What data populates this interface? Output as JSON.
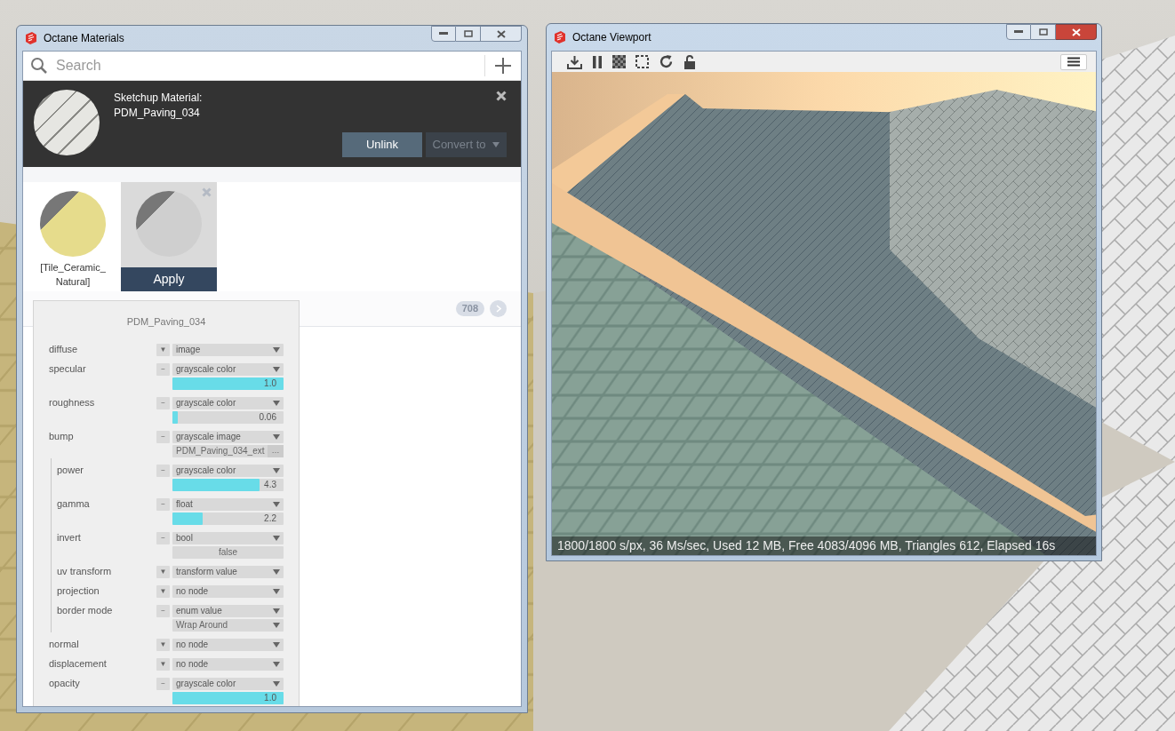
{
  "materials_window": {
    "title": "Octane Materials",
    "search": {
      "placeholder": "Search"
    },
    "linked_material": {
      "heading": "Sketchup Material:",
      "name": "PDM_Paving_034",
      "buttons": [
        {
          "label": "Unlink",
          "kind": "primary",
          "disabled": false
        },
        {
          "label": "Convert to",
          "kind": "dropdown",
          "disabled": true
        }
      ]
    },
    "materials": [
      {
        "name": "[Tile_Ceramic_Natural]",
        "selected": false,
        "color": "#e6dc8c"
      },
      {
        "selected": true,
        "action": "Apply",
        "color": "#cfcfcf"
      }
    ],
    "category_count": "708",
    "editor": {
      "title": "PDM_Paving_034",
      "params": [
        {
          "label": "diffuse",
          "toggle": "▼",
          "type": "image"
        },
        {
          "label": "specular",
          "toggle": "−",
          "type": "grayscale color",
          "sub": {
            "kind": "slider",
            "level": 1,
            "reading": "1.0"
          }
        },
        {
          "label": "roughness",
          "toggle": "−",
          "type": "grayscale color",
          "sub": {
            "kind": "slider",
            "level": 0.05,
            "reading": "0.06"
          }
        },
        {
          "label": "bump",
          "toggle": "−",
          "type": "grayscale image",
          "sub": {
            "kind": "file",
            "value": "PDM_Paving_034_ext",
            "button": "…"
          },
          "children": [
            {
              "label": "power",
              "toggle": "−",
              "type": "grayscale color",
              "sub": {
                "kind": "slider",
                "level": 0.78,
                "reading": "4.3"
              }
            },
            {
              "label": "gamma",
              "toggle": "−",
              "type": "float",
              "sub": {
                "kind": "slider",
                "level": 0.27,
                "reading": "2.2"
              }
            },
            {
              "label": "invert",
              "toggle": "−",
              "type": "bool",
              "sub": {
                "kind": "value",
                "value": "false"
              }
            },
            {
              "label": "uv transform",
              "toggle": "▼",
              "type": "transform value"
            },
            {
              "label": "projection",
              "toggle": "▼",
              "type": "no node"
            },
            {
              "label": "border mode",
              "toggle": "−",
              "type": "enum value",
              "sub": {
                "kind": "enum",
                "value": "Wrap Around"
              }
            }
          ]
        },
        {
          "label": "normal",
          "toggle": "▼",
          "type": "no node"
        },
        {
          "label": "displacement",
          "toggle": "▼",
          "type": "no node"
        },
        {
          "label": "opacity",
          "toggle": "−",
          "type": "grayscale color",
          "sub": {
            "kind": "slider",
            "level": 1,
            "reading": "1.0"
          }
        }
      ]
    }
  },
  "viewport_window": {
    "title": "Octane Viewport",
    "status": "1800/1800 s/px, 36 Ms/sec, Used 12 MB, Free 4083/4096 MB, Triangles 612, Elapsed 16s"
  }
}
